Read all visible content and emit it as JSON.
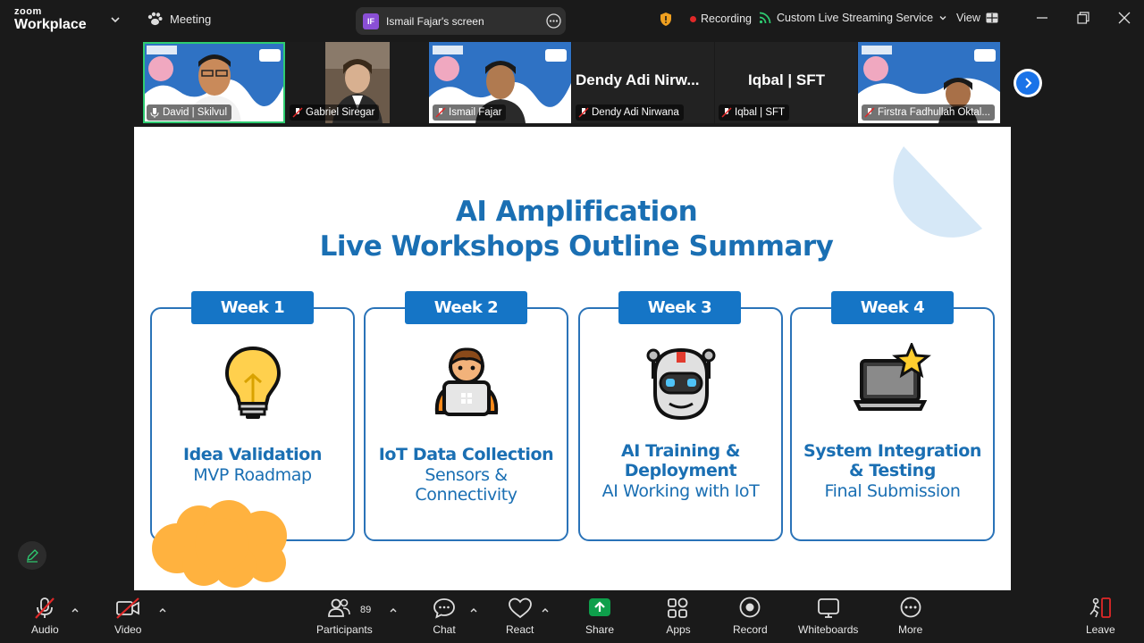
{
  "app": {
    "brand_small": "zoom",
    "brand_large": "Workplace"
  },
  "topbar": {
    "meeting_label": "Meeting",
    "share_badge": "IF",
    "share_label": "Ismail Fajar's screen",
    "recording_label": "Recording",
    "live_label": "Custom Live Streaming Service",
    "view_label": "View"
  },
  "participants": [
    {
      "name": "David | Skilvul",
      "active": true
    },
    {
      "name": "Gabriel Siregar"
    },
    {
      "name": "Ismail Fajar"
    },
    {
      "name": "Dendy Adi Nirwana",
      "big_name": "Dendy  Adi  Nirw..."
    },
    {
      "name": "Iqbal | SFT",
      "big_name": "Iqbal | SFT"
    },
    {
      "name": "Firstra Fadhullah Oktal..."
    }
  ],
  "slide": {
    "title_line1": "AI Amplification",
    "title_line2": "Live Workshops Outline Summary",
    "weeks": [
      {
        "tag": "Week 1",
        "heading": [
          "Idea Validation"
        ],
        "sub": [
          "MVP Roadmap"
        ]
      },
      {
        "tag": "Week 2",
        "heading": [
          "IoT Data Collection"
        ],
        "sub": [
          "Sensors &",
          "Connectivity"
        ]
      },
      {
        "tag": "Week 3",
        "heading": [
          "AI Training &",
          "Deployment"
        ],
        "sub": [
          "AI Working with IoT"
        ]
      },
      {
        "tag": "Week 4",
        "heading": [
          "System Integration",
          "& Testing"
        ],
        "sub": [
          "Final Submission"
        ]
      }
    ]
  },
  "toolbar": {
    "audio": "Audio",
    "video": "Video",
    "participants": "Participants",
    "participant_count": "89",
    "chat": "Chat",
    "react": "React",
    "share": "Share",
    "apps": "Apps",
    "record": "Record",
    "whiteboards": "Whiteboards",
    "more": "More",
    "leave": "Leave"
  },
  "colors": {
    "slide_blue": "#1a6fb3",
    "tag_blue": "#1575c6",
    "recording_red": "#e02828",
    "share_green": "#0e9f4b",
    "active_speaker": "#2ecc71"
  }
}
